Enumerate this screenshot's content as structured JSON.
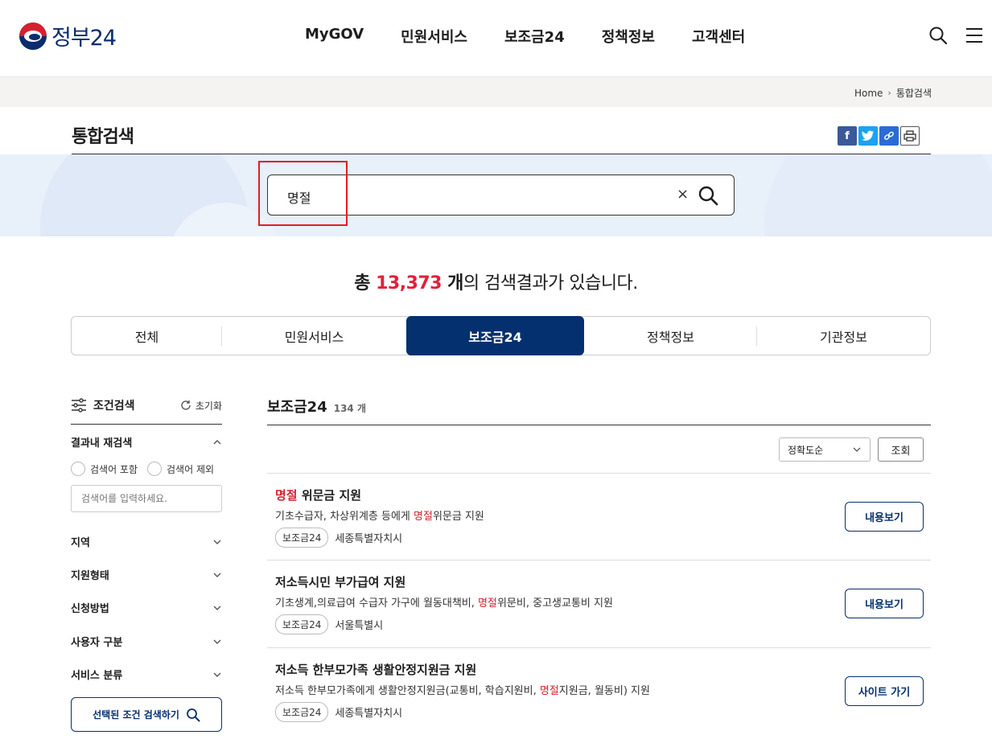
{
  "header": {
    "logo_text": "정부24",
    "nav": [
      "MyGOV",
      "민원서비스",
      "보조금24",
      "정책정보",
      "고객센터"
    ]
  },
  "breadcrumb": {
    "home": "Home",
    "current": "통합검색"
  },
  "page": {
    "title": "통합검색"
  },
  "search": {
    "value": "명절",
    "clear": "×"
  },
  "summary": {
    "prefix": "총 ",
    "count": "13,373",
    "unit": " 개",
    "suffix": "의 검색결과가 있습니다."
  },
  "tabs": [
    {
      "label": "전체"
    },
    {
      "label": "민원서비스"
    },
    {
      "label": "보조금24",
      "active": true
    },
    {
      "label": "정책정보"
    },
    {
      "label": "기관정보"
    }
  ],
  "sidebar": {
    "title": "조건검색",
    "reset": "초기화",
    "refine_title": "결과내 재검색",
    "radio_include": "검색어 포함",
    "radio_exclude": "검색어 제외",
    "input_placeholder": "검색어를 입력하세요.",
    "filters": [
      "지역",
      "지원형태",
      "신청방법",
      "사용자 구분",
      "서비스 분류"
    ],
    "submit": "선택된 조건 검색하기"
  },
  "results": {
    "title": "보조금24",
    "count": "134 개",
    "sort_value": "정확도순",
    "sort_button": "조회",
    "items": [
      {
        "title_hl": "명절",
        "title_rest": " 위문금 지원",
        "desc_pre": "기초수급자, 차상위계층 등에게 ",
        "desc_hl": "명절",
        "desc_post": "위문금 지원",
        "tag": "보조금24",
        "region": "세종특별자치시",
        "button": "내용보기"
      },
      {
        "title_hl": "",
        "title_rest": "저소득시민 부가급여 지원",
        "desc_pre": "기초생계,의료급여 수급자 가구에 월동대책비, ",
        "desc_hl": "명절",
        "desc_post": "위문비, 중고생교통비 지원",
        "tag": "보조금24",
        "region": "서울특별시",
        "button": "내용보기"
      },
      {
        "title_hl": "",
        "title_rest": "저소득 한부모가족 생활안정지원금 지원",
        "desc_pre": "저소득 한부모가족에게 생활안정지원금(교통비, 학습지원비, ",
        "desc_hl": "명절",
        "desc_post": "지원금, 월동비) 지원",
        "tag": "보조금24",
        "region": "세종특별자치시",
        "button": "사이트 가기"
      }
    ]
  },
  "colors": {
    "brand_navy": "#05306f",
    "highlight_red": "#d6202f",
    "annotation_red": "#e31d1d"
  }
}
